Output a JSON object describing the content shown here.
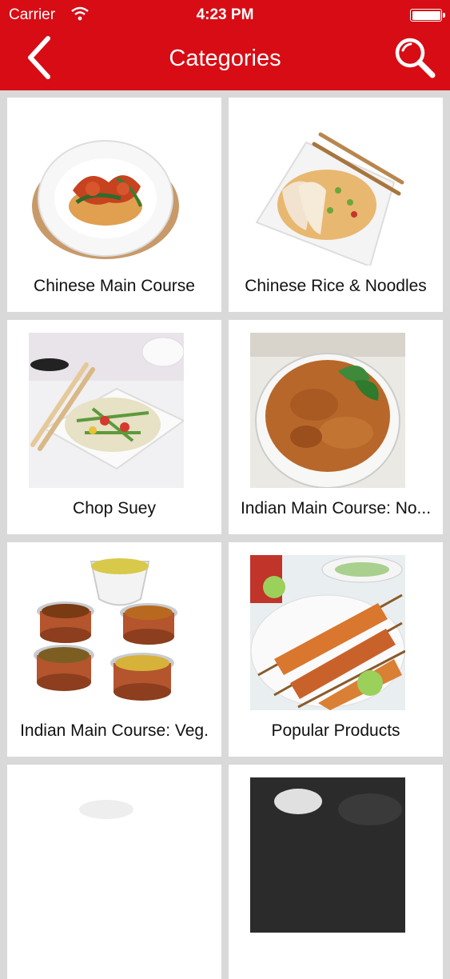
{
  "status_bar": {
    "carrier": "Carrier",
    "time": "4:23 PM"
  },
  "header": {
    "title": "Categories"
  },
  "categories": [
    {
      "label": "Chinese Main Course"
    },
    {
      "label": "Chinese Rice & Noodles"
    },
    {
      "label": "Chop Suey"
    },
    {
      "label": "Indian Main Course: No..."
    },
    {
      "label": "Indian Main Course: Veg."
    },
    {
      "label": "Popular Products"
    },
    {
      "label": ""
    },
    {
      "label": ""
    }
  ],
  "colors": {
    "header": "#d80c14",
    "background": "#d9d9d9",
    "card": "#ffffff"
  },
  "icons": {
    "back": "chevron-left-icon",
    "search": "search-icon",
    "wifi": "wifi-icon",
    "battery": "battery-icon"
  }
}
